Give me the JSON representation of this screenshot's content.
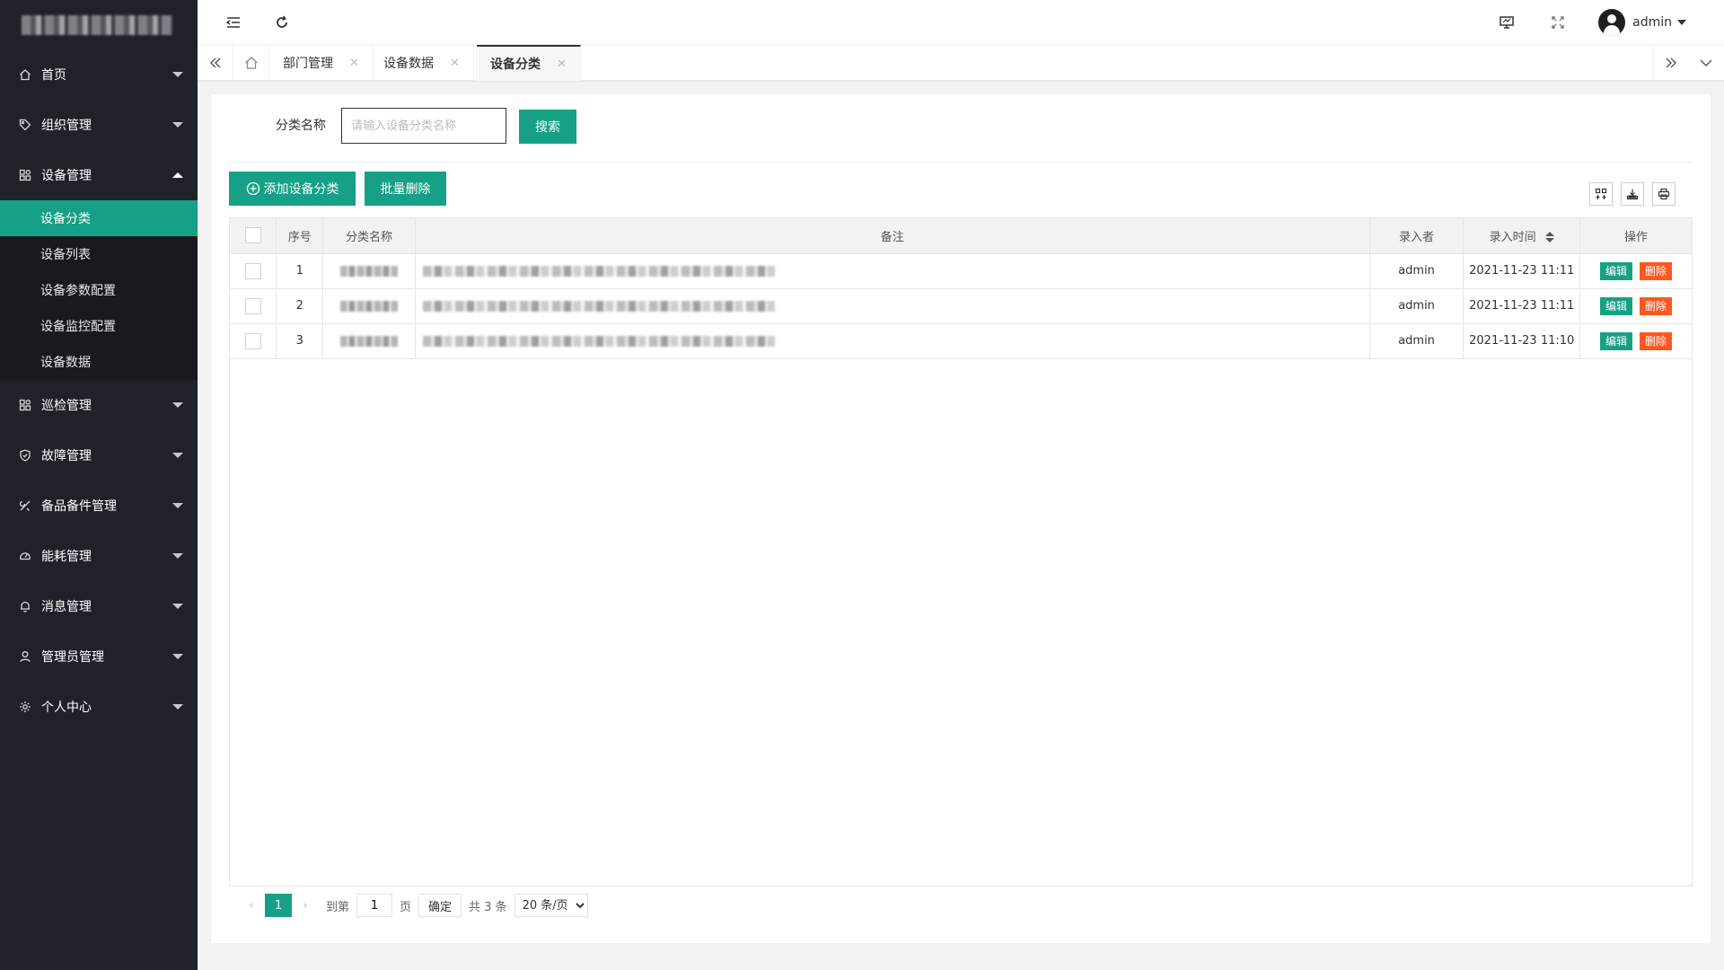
{
  "sidebar": {
    "items": [
      {
        "label": "首页",
        "icon": "home-icon"
      },
      {
        "label": "组织管理",
        "icon": "tag-icon"
      },
      {
        "label": "设备管理",
        "icon": "apps-icon",
        "expanded": true,
        "children": [
          {
            "label": "设备分类",
            "active": true
          },
          {
            "label": "设备列表"
          },
          {
            "label": "设备参数配置"
          },
          {
            "label": "设备监控配置"
          },
          {
            "label": "设备数据"
          }
        ]
      },
      {
        "label": "巡检管理",
        "icon": "apps-icon"
      },
      {
        "label": "故障管理",
        "icon": "shield-icon"
      },
      {
        "label": "备品备件管理",
        "icon": "tools-icon"
      },
      {
        "label": "能耗管理",
        "icon": "gauge-icon"
      },
      {
        "label": "消息管理",
        "icon": "bell-icon"
      },
      {
        "label": "管理员管理",
        "icon": "user-icon"
      },
      {
        "label": "个人中心",
        "icon": "gear-icon"
      }
    ]
  },
  "header": {
    "user_name": "admin"
  },
  "tabs": [
    {
      "label": "部门管理",
      "closable": true,
      "active": false
    },
    {
      "label": "设备数据",
      "closable": true,
      "active": false
    },
    {
      "label": "设备分类",
      "closable": true,
      "active": true
    }
  ],
  "search": {
    "label": "分类名称",
    "placeholder": "请输入设备分类名称",
    "value": "",
    "button": "搜索"
  },
  "toolbar": {
    "add_label": "添加设备分类",
    "batch_delete_label": "批量删除"
  },
  "table": {
    "columns": [
      "",
      "序号",
      "分类名称",
      "备注",
      "录入者",
      "录入时间",
      "操作"
    ],
    "rows": [
      {
        "index": "1",
        "creator": "admin",
        "time": "2021-11-23 11:11"
      },
      {
        "index": "2",
        "creator": "admin",
        "time": "2021-11-23 11:11"
      },
      {
        "index": "3",
        "creator": "admin",
        "time": "2021-11-23 11:10"
      }
    ],
    "edit_label": "编辑",
    "delete_label": "删除"
  },
  "pagination": {
    "current": "1",
    "goto_prefix": "到第",
    "goto_value": "1",
    "page_suffix": "页",
    "confirm": "确定",
    "total": "共 3 条",
    "page_size": "20 条/页"
  },
  "colors": {
    "accent": "#16a085",
    "sidebar_bg": "#20222a",
    "danger": "#ff5722"
  }
}
